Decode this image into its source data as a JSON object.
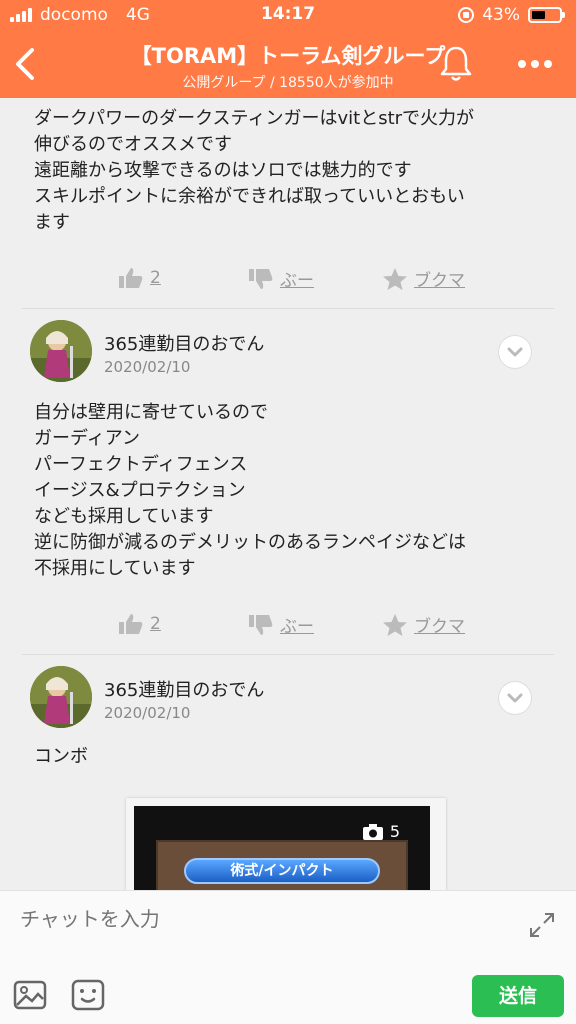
{
  "status_bar": {
    "carrier": "docomo",
    "network": "4G",
    "time": "14:17",
    "battery": "43%"
  },
  "header": {
    "title": "【TORAM】トーラム剣グループ",
    "subtitle": "公開グループ / 18550人が参加中"
  },
  "posts": [
    {
      "lines": [
        "ダークパワーのダークスティンガーはvitとstrで火力が",
        "伸びるのでオススメです",
        "遠距離から攻撃できるのはソロでは魅力的です",
        "スキルポイントに余裕ができれば取っていいとおもい",
        "ます"
      ],
      "like_count": "2",
      "boo_label": "ぶー",
      "bookmark_label": "ブクマ"
    },
    {
      "author": "365連勤目のおでん",
      "date": "2020/02/10",
      "lines": [
        "自分は壁用に寄せているので",
        "ガーディアン",
        "パーフェクトディフェンス",
        "イージス&プロテクション",
        "なども採用しています",
        "逆に防御が減るのデメリットのあるランペイジなどは",
        "不採用にしています"
      ],
      "like_count": "2",
      "boo_label": "ぶー",
      "bookmark_label": "ブクマ"
    },
    {
      "author": "365連勤目のおでん",
      "date": "2020/02/10",
      "lines": [
        "コンボ"
      ],
      "photo": {
        "count": "5",
        "button_text": "術式/インパクト"
      }
    }
  ],
  "composer": {
    "placeholder": "チャットを入力",
    "send_label": "送信"
  },
  "colors": {
    "header": "#ff7a45",
    "send": "#2bbf53"
  },
  "icons": [
    "back-icon",
    "bell-icon",
    "more-icon",
    "thumbs-up-icon",
    "thumbs-down-icon",
    "star-icon",
    "chevron-down-icon",
    "camera-icon",
    "expand-icon",
    "image-icon",
    "emoji-icon"
  ]
}
